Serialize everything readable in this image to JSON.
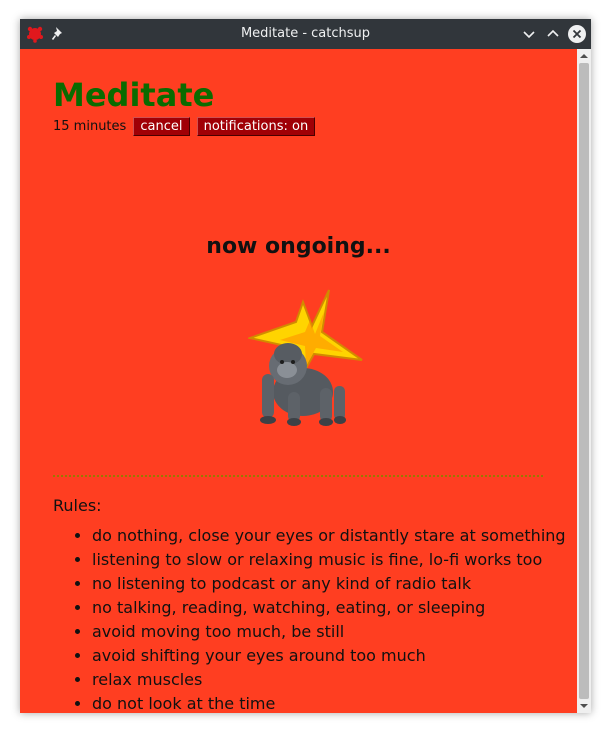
{
  "window": {
    "title": "Meditate - catchsup",
    "controls": [
      "minimize",
      "maximize",
      "close"
    ]
  },
  "activity": {
    "title": "Meditate",
    "duration": "15 minutes",
    "cancel_label": "cancel",
    "notifications_label": "notifications: on",
    "status": "now ongoing...",
    "illustration": [
      "star",
      "gorilla"
    ]
  },
  "rules": {
    "heading": "Rules:",
    "items": [
      "do nothing, close your eyes or distantly stare at something",
      "listening to slow or relaxing music is fine, lo-fi works too",
      "no listening to podcast or any kind of radio talk",
      "no talking, reading, watching, eating, or sleeping",
      "avoid moving too much, be still",
      "avoid shifting your eyes around too much",
      "relax muscles",
      "do not look at the time"
    ]
  },
  "colors": {
    "background": "#ff3e21",
    "title": "#0a6b00",
    "button": "#a00006",
    "titlebar": "#31363b",
    "star": "#ffd400"
  },
  "icons": {
    "app": "app-bug-icon",
    "pin": "pin-icon",
    "minimize": "chevron-down-icon",
    "maximize": "chevron-up-icon",
    "close": "close-icon"
  }
}
